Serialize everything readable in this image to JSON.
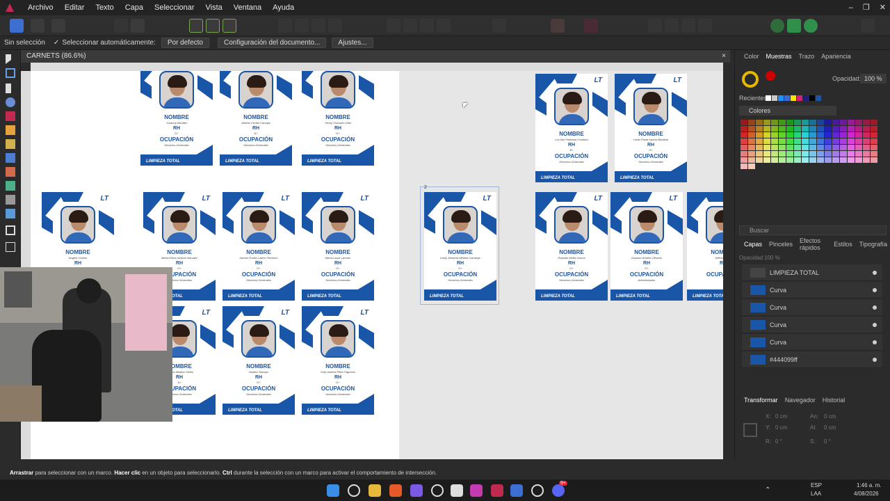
{
  "menubar": {
    "items": [
      "Archivo",
      "Editar",
      "Texto",
      "Capa",
      "Seleccionar",
      "Vista",
      "Ventana",
      "Ayuda"
    ],
    "window_controls": [
      "–",
      "❐",
      "✕"
    ]
  },
  "contextbar": {
    "selection": "Sin selección",
    "auto_select_label": "Seleccionar automáticamente:",
    "auto_select_value": "Por defecto",
    "doc_setup": "Configuración del documento...",
    "settings": "Ajustes..."
  },
  "document": {
    "tab_title": "CARNETS (86.6%)",
    "close": "×",
    "page2_number": "2"
  },
  "card_text": {
    "nombre": "NOMBRE",
    "rh": "RH",
    "ocupacion": "OCUPACIÓN",
    "footer": "LIMPIEZA TOTAL",
    "logo": "LT"
  },
  "cards": [
    {
      "name": "Yuranny Morales",
      "rh": "O+",
      "job": "Servicios Generales"
    },
    {
      "name": "Martha Cecilia Carvajal",
      "rh": "A+",
      "job": "Servicios Generales"
    },
    {
      "name": "Yenny Chavarro Ortiz",
      "rh": "O+",
      "job": "Servicios Generales"
    },
    {
      "name": "Luz Ibis Pastrana Córdoba",
      "rh": "B+",
      "job": "Servicios Generales"
    },
    {
      "name": "Linda Paola capera Bautista",
      "rh": "O+",
      "job": "Servicios Generales"
    },
    {
      "name": "Angela Cuellar",
      "rh": "",
      "job": ""
    },
    {
      "name": "María Elena molano Narváez",
      "rh": "O+",
      "job": "Servicios Generales"
    },
    {
      "name": "Jazmín Evelia Castro Perdomo",
      "rh": "O+",
      "job": "Servicios Generales"
    },
    {
      "name": "María Laura Lizcano",
      "rh": "O+",
      "job": "Servicios Generales"
    },
    {
      "name": "Leidy Johanna Medina Camargo",
      "rh": "O+",
      "job": "Servicios Generales"
    },
    {
      "name": "Rolando Motta García",
      "rh": "O+",
      "job": "Servicios Generales"
    },
    {
      "name": "Gustavo Andrés Olivaros",
      "rh": "O+",
      "job": "Administrador"
    },
    {
      "name": "Jefferson Per",
      "rh": "",
      "job": ""
    },
    {
      "name": "Jessica Medina Yáñez",
      "rh": "A+",
      "job": "Servicios Generales"
    },
    {
      "name": "Martha Tamayo",
      "rh": "O+",
      "job": "Servicios Generales"
    },
    {
      "name": "Yully Andrea Peña Trigueros",
      "rh": "O+",
      "job": "Servicios Generales"
    }
  ],
  "right_panel": {
    "tabs_top": [
      "Color",
      "Muestras",
      "Trazo",
      "Apariencia"
    ],
    "active_top": "Muestras",
    "opacity_label": "Opacidad:",
    "opacity_value": "100 %",
    "recent_label": "Recientes:",
    "palette_name": "Colores",
    "search_placeholder": "Buscar",
    "tabs_mid": [
      "Capas",
      "Pinceles",
      "Efectos rápidos",
      "Estilos",
      "Tipografía"
    ],
    "active_mid": "Capas",
    "layer_opacity_label": "Opacidad",
    "layer_opacity_value": "100 %",
    "layers": [
      "LIMPIEZA TOTAL",
      "Curva",
      "Curva",
      "Curva",
      "Curva",
      "#444099ff"
    ],
    "tabs_bottom": [
      "Transformar",
      "Navegador",
      "Historial"
    ],
    "active_bottom": "Transformar",
    "transform": {
      "x": "0 cm",
      "y": "0 cm",
      "w": "0 cm",
      "h": "0 cm",
      "r": "0 °",
      "s": "0 °"
    },
    "labels": {
      "x": "X:",
      "y": "Y:",
      "w": "An:",
      "h": "Al:",
      "r": "R:",
      "s": "S:"
    }
  },
  "statusbar": {
    "k1": "Arrastrar",
    "t1": " para seleccionar con un marco. ",
    "k2": "Hacer clic",
    "t2": " en un objeto para seleccionarlo. ",
    "k3": "Ctrl",
    "t3": " durante la selección con un marco para activar el comportamiento de intersección."
  },
  "taskbar": {
    "lang_top": "ESP",
    "lang_bottom": "LAA",
    "time": "1:46 a. m.",
    "date": "4/08/2026",
    "badge": "9+"
  },
  "swatch_colors": [
    "#ffffff",
    "#cccccc",
    "#1e90ff",
    "#3a6bd6",
    "#ffe400",
    "#d61f7a",
    "#1f1f7a",
    "#000000",
    "#1a56a8"
  ],
  "brand_color": "#1a56a8"
}
